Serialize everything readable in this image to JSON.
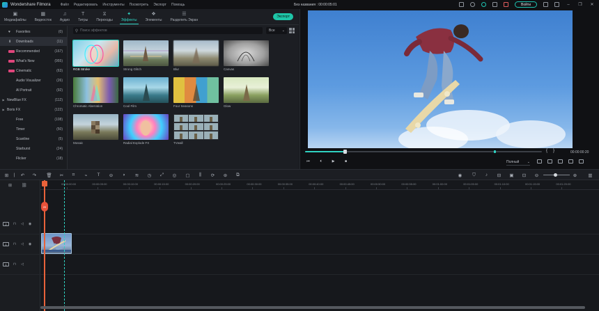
{
  "app": {
    "title": "Wondershare Filmora",
    "menu": [
      "Файл",
      "Редактировать",
      "Инструменты",
      "Посмотреть",
      "Экспорт",
      "Помощь"
    ],
    "document_title": "Без названия :  00:00:05:01",
    "login_label": "Войти"
  },
  "tabs": [
    {
      "label": "Медиафайлы",
      "icon": "folder-icon",
      "glyph": "▣"
    },
    {
      "label": "Видеосток",
      "icon": "stock-icon",
      "glyph": "▦"
    },
    {
      "label": "Аудио",
      "icon": "music-icon",
      "glyph": "♫"
    },
    {
      "label": "Титры",
      "icon": "title-icon",
      "glyph": "T"
    },
    {
      "label": "Переходы",
      "icon": "transition-icon",
      "glyph": "⧖"
    },
    {
      "label": "Эффекты",
      "icon": "effects-icon",
      "glyph": "✦",
      "active": true
    },
    {
      "label": "Элементы",
      "icon": "elements-icon",
      "glyph": "❖"
    },
    {
      "label": "Разделить Экран",
      "icon": "split-screen-icon",
      "glyph": "☰"
    }
  ],
  "export_label": "Экспорт",
  "sidebar": [
    {
      "label": "Favorites",
      "count": "(0)",
      "icon": "heart-icon",
      "glyph": "♥"
    },
    {
      "label": "Downloads",
      "count": "(11)",
      "icon": "download-icon",
      "glyph": "⬇",
      "selected": true
    },
    {
      "label": "Recommended",
      "count": "(167)",
      "new": true
    },
    {
      "label": "What's New",
      "count": "(955)",
      "new": true
    },
    {
      "label": "Cinematic",
      "count": "(63)",
      "new": true
    },
    {
      "label": "Audio Visualizer",
      "count": "(26)"
    },
    {
      "label": "AI Portrait",
      "count": "(92)"
    },
    {
      "label": "NewBlue FX",
      "count": "(112)",
      "arrow": true
    },
    {
      "label": "Boris FX",
      "count": "(122)",
      "arrow": true
    },
    {
      "label": "Free",
      "count": "(108)"
    },
    {
      "label": "Timer",
      "count": "(50)"
    },
    {
      "label": "Scanline",
      "count": "(5)"
    },
    {
      "label": "Starburst",
      "count": "(24)"
    },
    {
      "label": "Flicker",
      "count": "(18)"
    }
  ],
  "search": {
    "placeholder": "Поиск эффектов",
    "value": ""
  },
  "filter": {
    "selected": "Все"
  },
  "effects": [
    {
      "name": "RGB Stroke",
      "selected": true
    },
    {
      "name": "Strong Glitch"
    },
    {
      "name": "Blur"
    },
    {
      "name": "Canvas"
    },
    {
      "name": "Chromatic Aberration"
    },
    {
      "name": "Cool Film"
    },
    {
      "name": "Four Seasons"
    },
    {
      "name": "Glow"
    },
    {
      "name": "Mosaic"
    },
    {
      "name": "Radial Explode FX"
    },
    {
      "name": "TVwall"
    }
  ],
  "preview": {
    "total_time": "00:00:00:20",
    "progress": 0.17,
    "quality": "Полный"
  },
  "timeline": {
    "ruler": [
      "00:00:00:00",
      "00:00:05:00",
      "00:00:10:00",
      "00:00:15:00",
      "00:00:20:00",
      "00:00:25:00",
      "00:00:30:00",
      "00:00:35:00",
      "00:00:40:00",
      "00:00:45:00",
      "00:00:50:00",
      "00:00:55:00",
      "00:01:00:00",
      "00:01:05:00",
      "00:01:10:00",
      "00:01:15:00",
      "00:01:20:00"
    ],
    "playhead_marker": "20",
    "tracks": [
      {
        "type": "video",
        "badge": "2"
      },
      {
        "type": "video",
        "badge": "1"
      },
      {
        "type": "audio",
        "badge": "1"
      }
    ]
  },
  "colors": {
    "accent": "#2fd3c2",
    "playhead": "#e8623a",
    "export": "#1ec6a8",
    "new_badge": "#e0457b"
  }
}
